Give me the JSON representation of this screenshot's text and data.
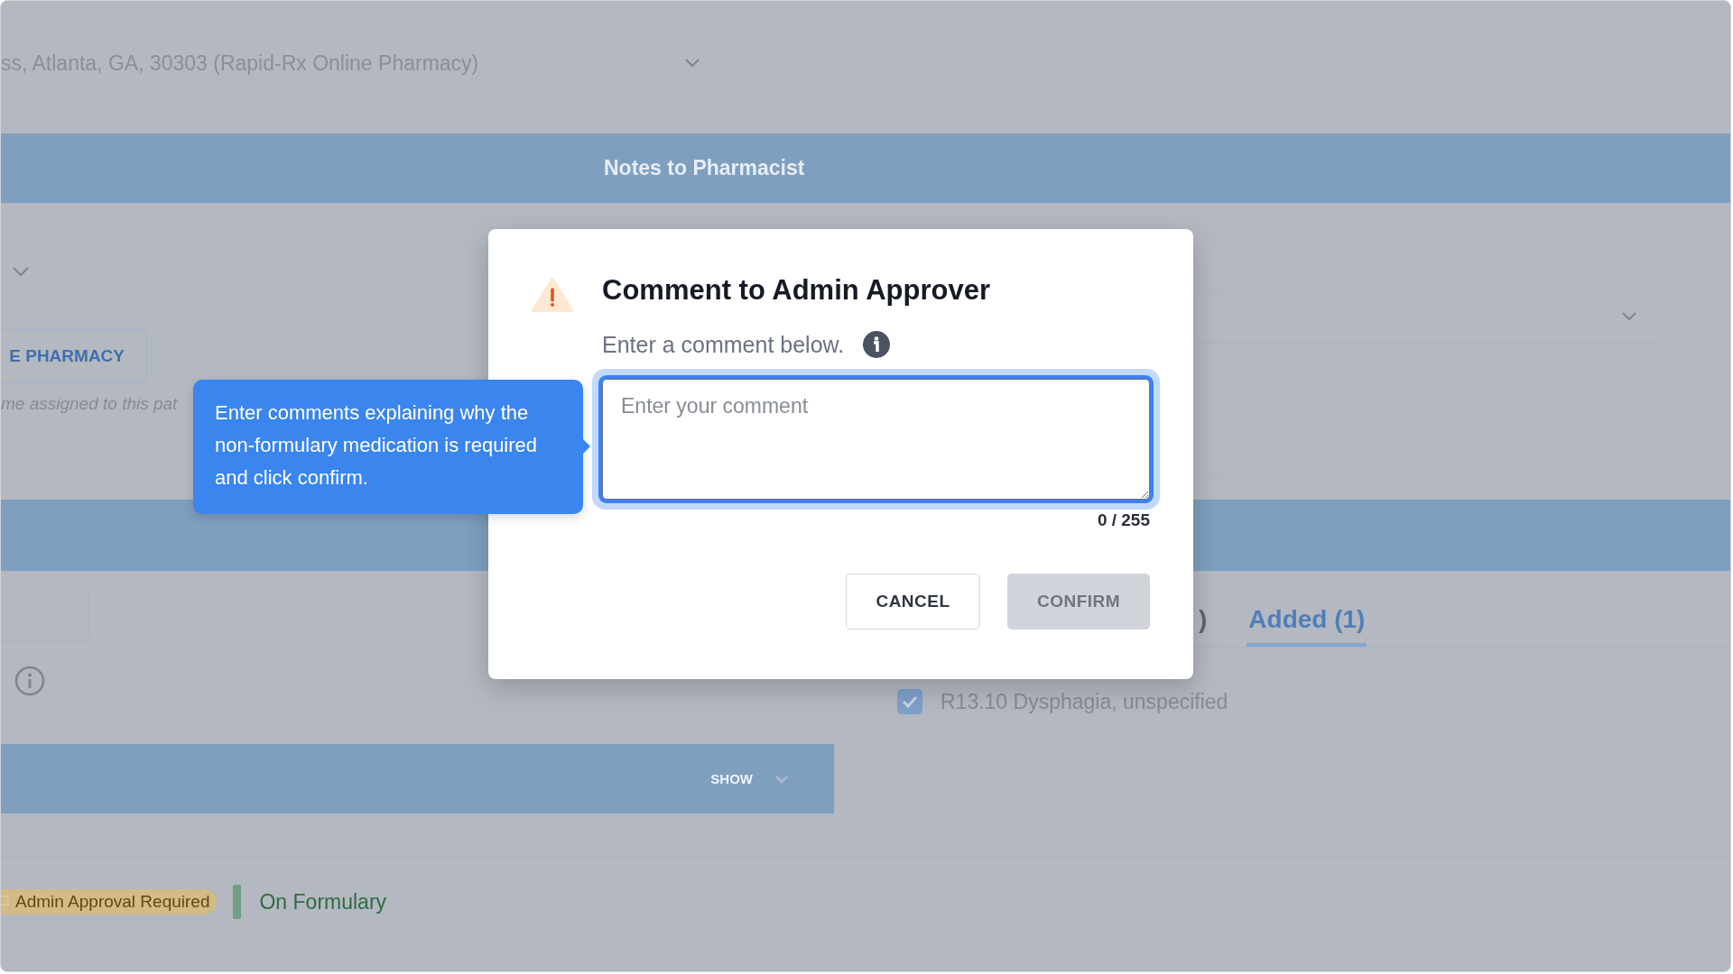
{
  "background": {
    "pharmacy_select": {
      "value": "ss, Atlanta, GA, 30303 (Rapid-Rx Online Pharmacy)"
    },
    "notes_band": {
      "title": "Notes to Pharmacist"
    },
    "pharmacy_button": {
      "label": "E PHARMACY"
    },
    "assignment_note": "me assigned to this pat",
    "section_band": {
      "toggle": "SHOW"
    },
    "tabs": [
      {
        "label": ")",
        "selected": false
      },
      {
        "label": "Added (1)",
        "selected": true
      }
    ],
    "diagnoses": [
      {
        "label": "R13.10 Dysphagia, unspecified",
        "checked": true
      }
    ],
    "badges": [
      {
        "label": "Admin Approval Required",
        "kind": "approval"
      },
      {
        "label": "On Formulary",
        "kind": "formulary"
      }
    ]
  },
  "tooltip": {
    "text": "Enter comments explaining why the non-formulary medication is required and click confirm."
  },
  "dialog": {
    "title": "Comment to Admin Approver",
    "prompt": "Enter a comment below.",
    "comment": {
      "placeholder": "Enter your comment",
      "counter": "0 / 255"
    },
    "buttons": [
      {
        "label": "CANCEL",
        "kind": "secondary",
        "disabled": false
      },
      {
        "label": "CONFIRM",
        "kind": "primary",
        "disabled": true
      }
    ]
  }
}
